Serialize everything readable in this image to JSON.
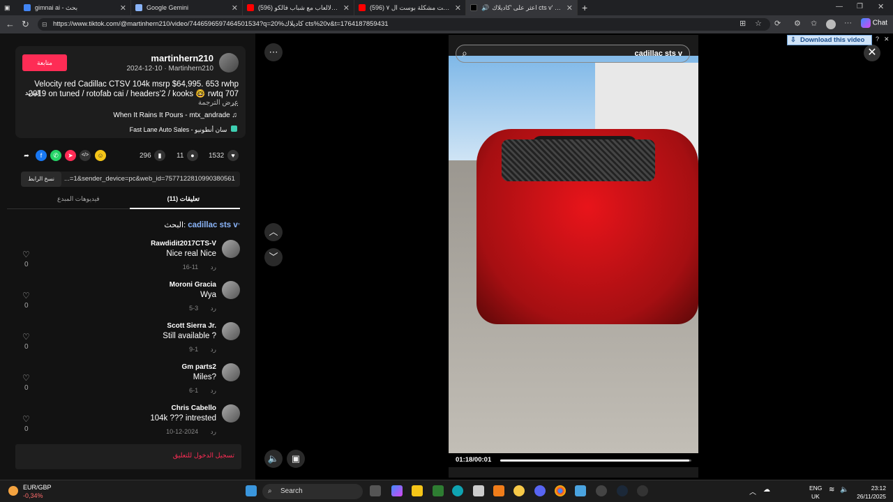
{
  "browser": {
    "tabs": [
      {
        "label": "gimnai ai - بحث",
        "icon_color": "#4285f4"
      },
      {
        "label": "Google Gemini",
        "icon_color": "#8ab4f8"
      },
      {
        "label": "(596) روليت الالعاب مع شباب فالكو...",
        "icon_color": "#ff0000"
      },
      {
        "label": "(596) أخيرا حليت مشكلة بوست ال ٧",
        "icon_color": "#ff0000"
      },
      {
        "label": "اعثر على 'كاديلاك cts v' على ...",
        "icon_color": "#000000"
      }
    ],
    "url": "https://www.tiktok.com/@martinhern210/video/7446596597464501534?q=20%كاديلاك cts%20v&t=1764187859431",
    "chat_label": "Chat"
  },
  "post": {
    "follow_label": "متابعة",
    "username": "martinhern210",
    "date_line": "2024-12-10 · Martinhern210",
    "description": "Velocity red Cadillac CTSV 104k msrp $64,995. 653 rwhp 2019 on tuned / rotofab cai / headers’2 / kooks 🤓 rwtq 707 ...",
    "more_label": "المزيد",
    "translate_label": "عرض الترجمة",
    "music": "When It Rains It Pours - mtx_andrade",
    "shop": "Fast Lane Auto Sales - سان أنطونيو",
    "likes": "1532",
    "comments_count": "11",
    "saves": "296",
    "copy_link_label": "نسخ الرابط",
    "link_text": "...=1&sender_device=pc&web_id=7577122810990380561",
    "tab_creator_videos": "فيديوهات المبدع",
    "tab_comments": "(11) تعليقات",
    "search_prefix": "البحث:",
    "search_term": "cadillac sts v"
  },
  "comments": [
    {
      "name": "Rawdidit2017CTS-V",
      "text": "Nice real Nice",
      "date": "11-16",
      "reply": "رد",
      "likes": "0"
    },
    {
      "name": "Moroni Gracia",
      "text": "Wya",
      "date": "3-5",
      "reply": "رد",
      "likes": "0"
    },
    {
      "name": "Scott Sierra Jr.",
      "text": "Still available ?",
      "date": "1-9",
      "reply": "رد",
      "likes": "0"
    },
    {
      "name": "Gm parts2",
      "text": "Miles?",
      "date": "1-6",
      "reply": "رد",
      "likes": "0"
    },
    {
      "name": "Chris Cabello",
      "text": "104k ??? intrested",
      "date": "2024-12-10",
      "reply": "رد",
      "likes": "0"
    }
  ],
  "login_label": "تسجيل الدخول للتعليق",
  "video": {
    "search_text": "cadillac sts v",
    "timecode": "01:18/00:01",
    "progress": 0.99
  },
  "download_label": "Download this video",
  "taskbar": {
    "weather_line1": "EUR/GBP",
    "weather_line2": "-0,34%",
    "search_placeholder": "Search",
    "lang1": "ENG",
    "lang2": "UK",
    "time": "23:12",
    "date": "26/11/2025"
  }
}
